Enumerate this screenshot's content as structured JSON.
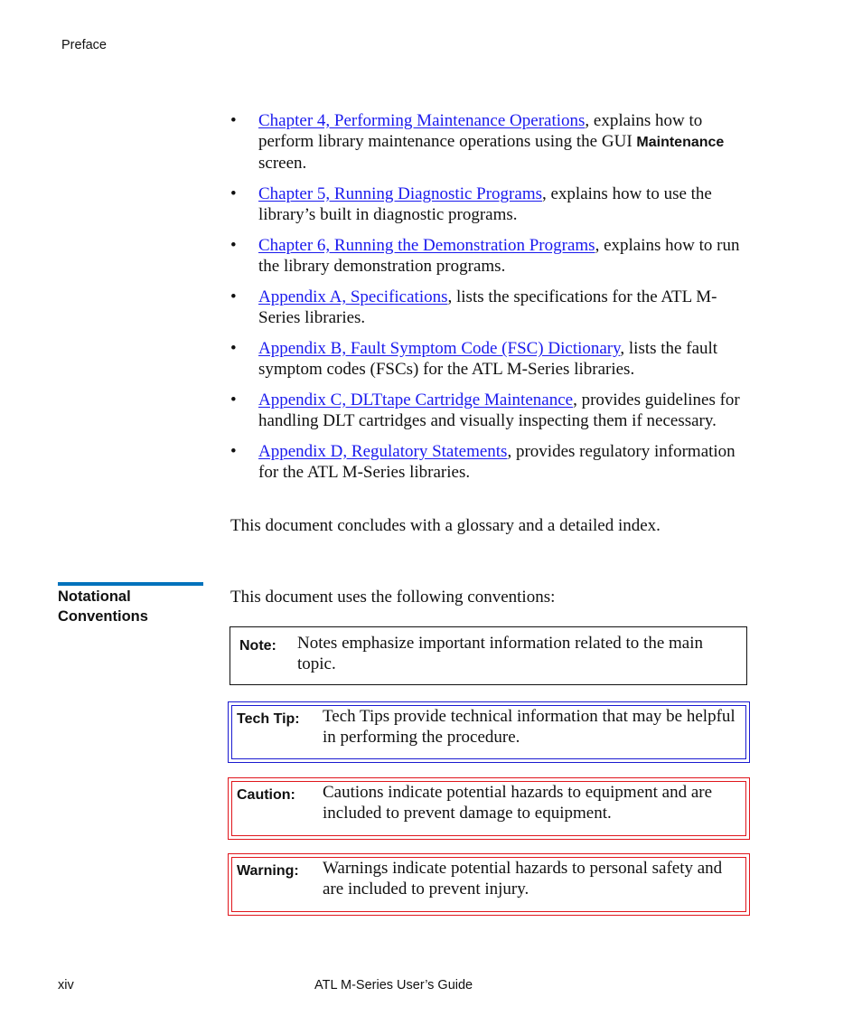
{
  "header": {
    "running_head": "Preface"
  },
  "bullets": [
    {
      "link": "Chapter 4, Performing Maintenance Operations",
      "text_before_ui": ", explains how to perform library maintenance operations using the GUI ",
      "ui_term": "Maintenance",
      "text_after_ui": " screen."
    },
    {
      "link": "Chapter 5, Running Diagnostic Programs",
      "text": ", explains how to use the library’s built in diagnostic programs."
    },
    {
      "link": "Chapter 6, Running the Demonstration Programs",
      "text": ", explains how to run the library demonstration programs."
    },
    {
      "link": "Appendix A, Specifications",
      "text": ", lists the specifications for the ATL M-Series libraries."
    },
    {
      "link": "Appendix B, Fault Symptom Code (FSC) Dictionary",
      "text": ", lists the fault symptom codes (FSCs) for the ATL M-Series libraries."
    },
    {
      "link": "Appendix C, DLTtape Cartridge Maintenance",
      "text": ", provides guidelines for handling DLT cartridges and visually inspecting them if necessary."
    },
    {
      "link": "Appendix D, Regulatory Statements",
      "text": ", provides regulatory information for the ATL M-Series libraries."
    }
  ],
  "bullet_glyph": "•",
  "conclusion": "This document concludes with a glossary and a detailed index.",
  "section": {
    "heading_line1": "Notational",
    "heading_line2": "Conventions",
    "intro": "This document uses the following conventions:",
    "accent_color": "#0072bc"
  },
  "conventions": {
    "note": {
      "label": "Note:",
      "text": "Notes emphasize important information related to the main topic."
    },
    "tech_tip": {
      "label": "Tech Tip:",
      "text": "Tech Tips provide technical information that may be helpful in performing the procedure.",
      "color": "#1a1ad0"
    },
    "caution": {
      "label": "Caution:",
      "text": "Cautions indicate potential hazards to equipment and are included to prevent damage to equipment.",
      "color": "#e0151b"
    },
    "warning": {
      "label": "Warning:",
      "text": "Warnings indicate potential hazards to personal safety and are included to prevent injury.",
      "color": "#e0151b"
    }
  },
  "footer": {
    "page_number": "xiv",
    "doc_title": "ATL M-Series User’s Guide"
  }
}
